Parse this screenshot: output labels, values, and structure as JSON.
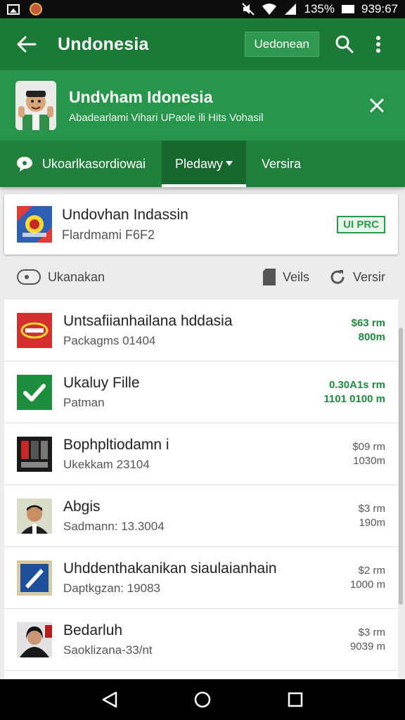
{
  "status_bar": {
    "battery": "135%",
    "time": "939:67"
  },
  "app_bar": {
    "title": "Undonesia",
    "chip_label": "Uedonean"
  },
  "banner": {
    "title": "Undvham Idonesia",
    "subtitle": "Abadearlami Vihari UPaole ili Hits Vohasil"
  },
  "tabs": [
    {
      "label": "Ukoarlkasordiowai",
      "icon": "chat-icon"
    },
    {
      "label": "Pledawy",
      "icon": "dropdown-icon"
    },
    {
      "label": "Versira"
    }
  ],
  "card": {
    "title": "Undovhan Indassin",
    "subtitle": "Flardmami F6F2",
    "badge": "UI PRC"
  },
  "filter_bar": {
    "left_label": "Ukanakan",
    "mid_label": "Veils",
    "right_label": "Versir"
  },
  "list": [
    {
      "title": "Untsafiianhailana hddasia",
      "subtitle": "Packagms 01404",
      "meta1": "$63 rm",
      "meta2": "800m",
      "green": true,
      "thumb": "red-logo"
    },
    {
      "title": "Ukaluy Fille",
      "subtitle": "Patman",
      "meta1": "0.30A1s rm",
      "meta2": "1101 0100 m",
      "green": true,
      "thumb": "green-check"
    },
    {
      "title": "Bophpltiodamn i",
      "subtitle": "Ukekkam 23104",
      "meta1": "$09 rm",
      "meta2": "1030m",
      "green": false,
      "thumb": "device"
    },
    {
      "title": "Abgis",
      "subtitle": "Sadmann: 13.3004",
      "meta1": "$3 rm",
      "meta2": "190m",
      "green": false,
      "thumb": "person-man"
    },
    {
      "title": "Uhddenthakanikan siaulaianhain",
      "subtitle": "Daptkgzan: 19083",
      "meta1": "$2 rm",
      "meta2": "1000 m",
      "green": false,
      "thumb": "frame"
    },
    {
      "title": "Bedarluh",
      "subtitle": "Saoklizana-33/nt",
      "meta1": "$3 rm",
      "meta2": "9039 m",
      "green": false,
      "thumb": "person-woman"
    }
  ],
  "colors": {
    "app_bar": "#1b7a35",
    "banner": "#27954a",
    "accent_green": "#1f8a3e"
  }
}
